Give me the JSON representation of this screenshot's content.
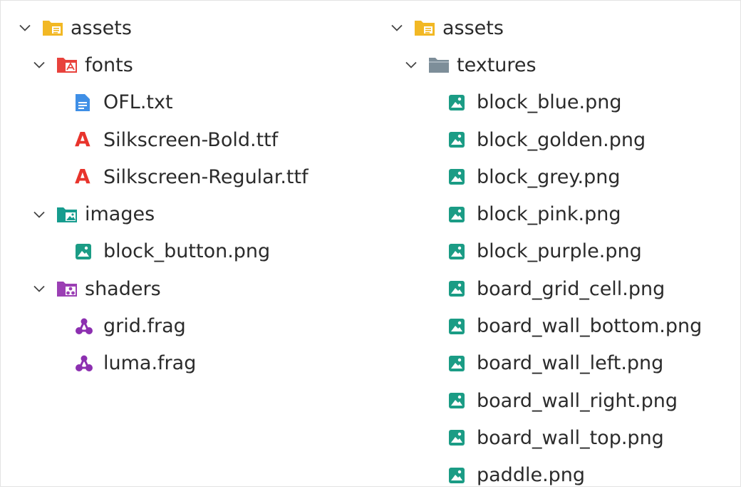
{
  "colors": {
    "assets_folder": "#f2b824",
    "fonts_folder": "#e8423c",
    "images_folder": "#169c8e",
    "shaders_folder": "#9b3fb4",
    "textures_folder": "#7d8e99",
    "text_file_icon": "#3f8fe6",
    "font_file_icon": "#e8342c",
    "image_file_icon": "#1b9c85",
    "shader_file_icon": "#8c2fb0"
  },
  "left_tree": {
    "root": "assets",
    "fonts_folder": "fonts",
    "fonts": [
      "OFL.txt",
      "Silkscreen-Bold.ttf",
      "Silkscreen-Regular.ttf"
    ],
    "images_folder": "images",
    "images": [
      "block_button.png"
    ],
    "shaders_folder": "shaders",
    "shaders": [
      "grid.frag",
      "luma.frag"
    ]
  },
  "right_tree": {
    "root": "assets",
    "textures_folder": "textures",
    "textures": [
      "block_blue.png",
      "block_golden.png",
      "block_grey.png",
      "block_pink.png",
      "block_purple.png",
      "board_grid_cell.png",
      "board_wall_bottom.png",
      "board_wall_left.png",
      "board_wall_right.png",
      "board_wall_top.png",
      "paddle.png"
    ]
  },
  "font_icon_glyph": "A"
}
